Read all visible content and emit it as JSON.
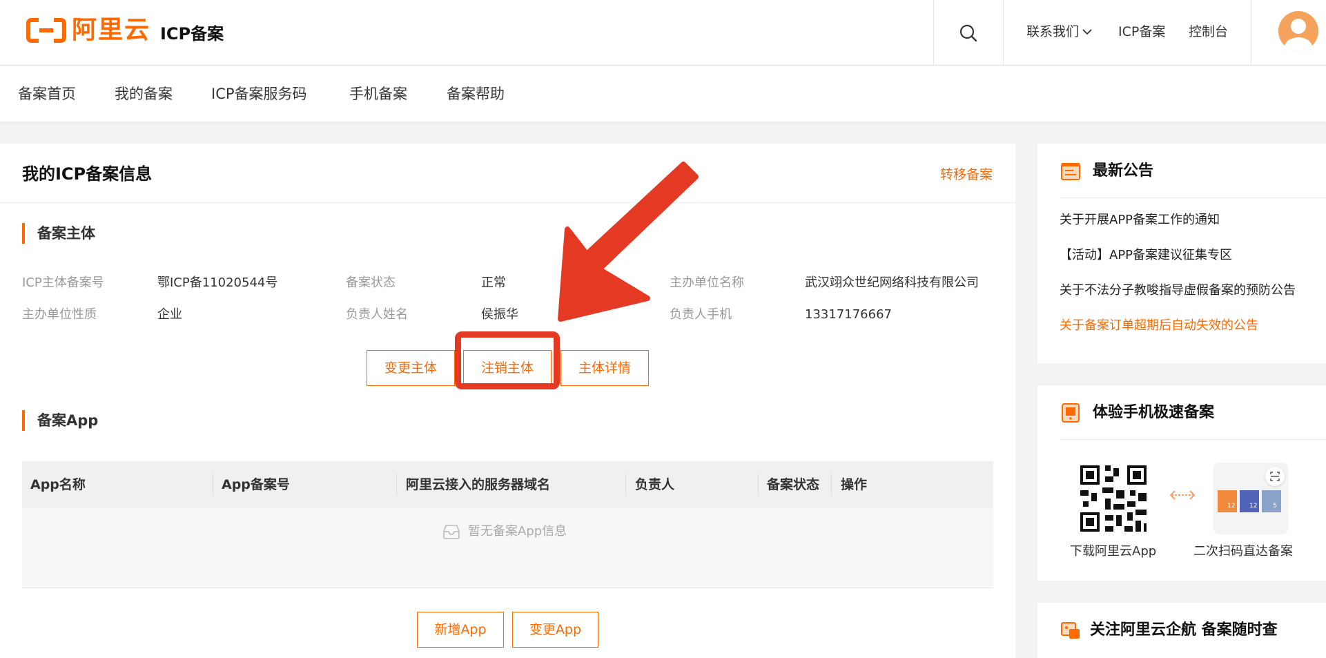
{
  "header": {
    "logo_text": "阿里云",
    "product_title": "ICP备案",
    "links": [
      "联系我们",
      "ICP备案",
      "控制台"
    ]
  },
  "nav": {
    "items": [
      "备案首页",
      "我的备案",
      "ICP备案服务码",
      "手机备案",
      "备案帮助"
    ]
  },
  "main": {
    "title": "我的ICP备案信息",
    "transfer_link": "转移备案",
    "subject_section": {
      "title": "备案主体",
      "fields": [
        {
          "label": "ICP主体备案号",
          "value": "鄂ICP备11020544号"
        },
        {
          "label": "备案状态",
          "value": "正常"
        },
        {
          "label": "主办单位名称",
          "value": "武汉翊众世纪网络科技有限公司"
        },
        {
          "label": "主办单位性质",
          "value": "企业"
        },
        {
          "label": "负责人姓名",
          "value": "侯振华"
        },
        {
          "label": "负责人手机",
          "value": "13317176667"
        }
      ],
      "buttons": [
        "变更主体",
        "注销主体",
        "主体详情"
      ]
    },
    "app_section": {
      "title": "备案App",
      "columns": [
        "App名称",
        "App备案号",
        "阿里云接入的服务器域名",
        "负责人",
        "备案状态",
        "操作"
      ],
      "empty_text": "暂无备案App信息",
      "buttons": [
        "新增App",
        "变更App"
      ]
    }
  },
  "sidebar": {
    "notices": {
      "title": "最新公告",
      "items": [
        {
          "text": "关于开展APP备案工作的通知"
        },
        {
          "text": "【活动】APP备案建议征集专区"
        },
        {
          "text": "关于不法分子教唆指导虚假备案的预防公告"
        },
        {
          "text": "关于备案订单超期后自动失效的公告"
        }
      ]
    },
    "mobile": {
      "title": "体验手机极速备案",
      "download_caption": "下载阿里云App",
      "scan_caption": "二次扫码直达备案",
      "preview_values": [
        "12",
        "12",
        "5"
      ]
    },
    "follow": {
      "title": "关注阿里云企航 备案随时查"
    }
  },
  "colors": {
    "accent": "#ff6a00",
    "annotation_red": "#e43a23"
  }
}
